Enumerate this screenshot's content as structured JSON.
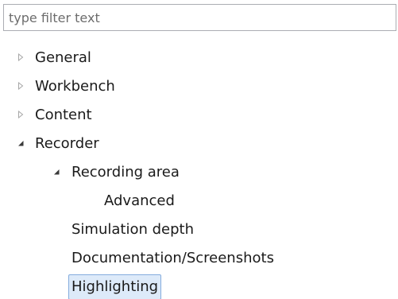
{
  "filter": {
    "placeholder": "type filter text",
    "value": ""
  },
  "tree": [
    {
      "label": "General",
      "depth": 0,
      "state": "collapsed",
      "selected": false
    },
    {
      "label": "Workbench",
      "depth": 0,
      "state": "collapsed",
      "selected": false
    },
    {
      "label": "Content",
      "depth": 0,
      "state": "collapsed",
      "selected": false
    },
    {
      "label": "Recorder",
      "depth": 0,
      "state": "expanded",
      "selected": false
    },
    {
      "label": "Recording area",
      "depth": 1,
      "state": "expanded",
      "selected": false
    },
    {
      "label": "Advanced",
      "depth": 2,
      "state": "leaf",
      "selected": false
    },
    {
      "label": "Simulation depth",
      "depth": 1,
      "state": "leaf",
      "selected": false
    },
    {
      "label": "Documentation/Screenshots",
      "depth": 1,
      "state": "leaf",
      "selected": false
    },
    {
      "label": "Highlighting",
      "depth": 1,
      "state": "leaf",
      "selected": true
    }
  ],
  "icons": {
    "collapsed": "chevron-right-icon",
    "expanded": "chevron-down-icon"
  },
  "colors": {
    "selection_background": "#ddeaf9",
    "selection_border": "#84acdd",
    "expander_collapsed": "#a6a6a6",
    "expander_expanded": "#3a3a3a"
  }
}
